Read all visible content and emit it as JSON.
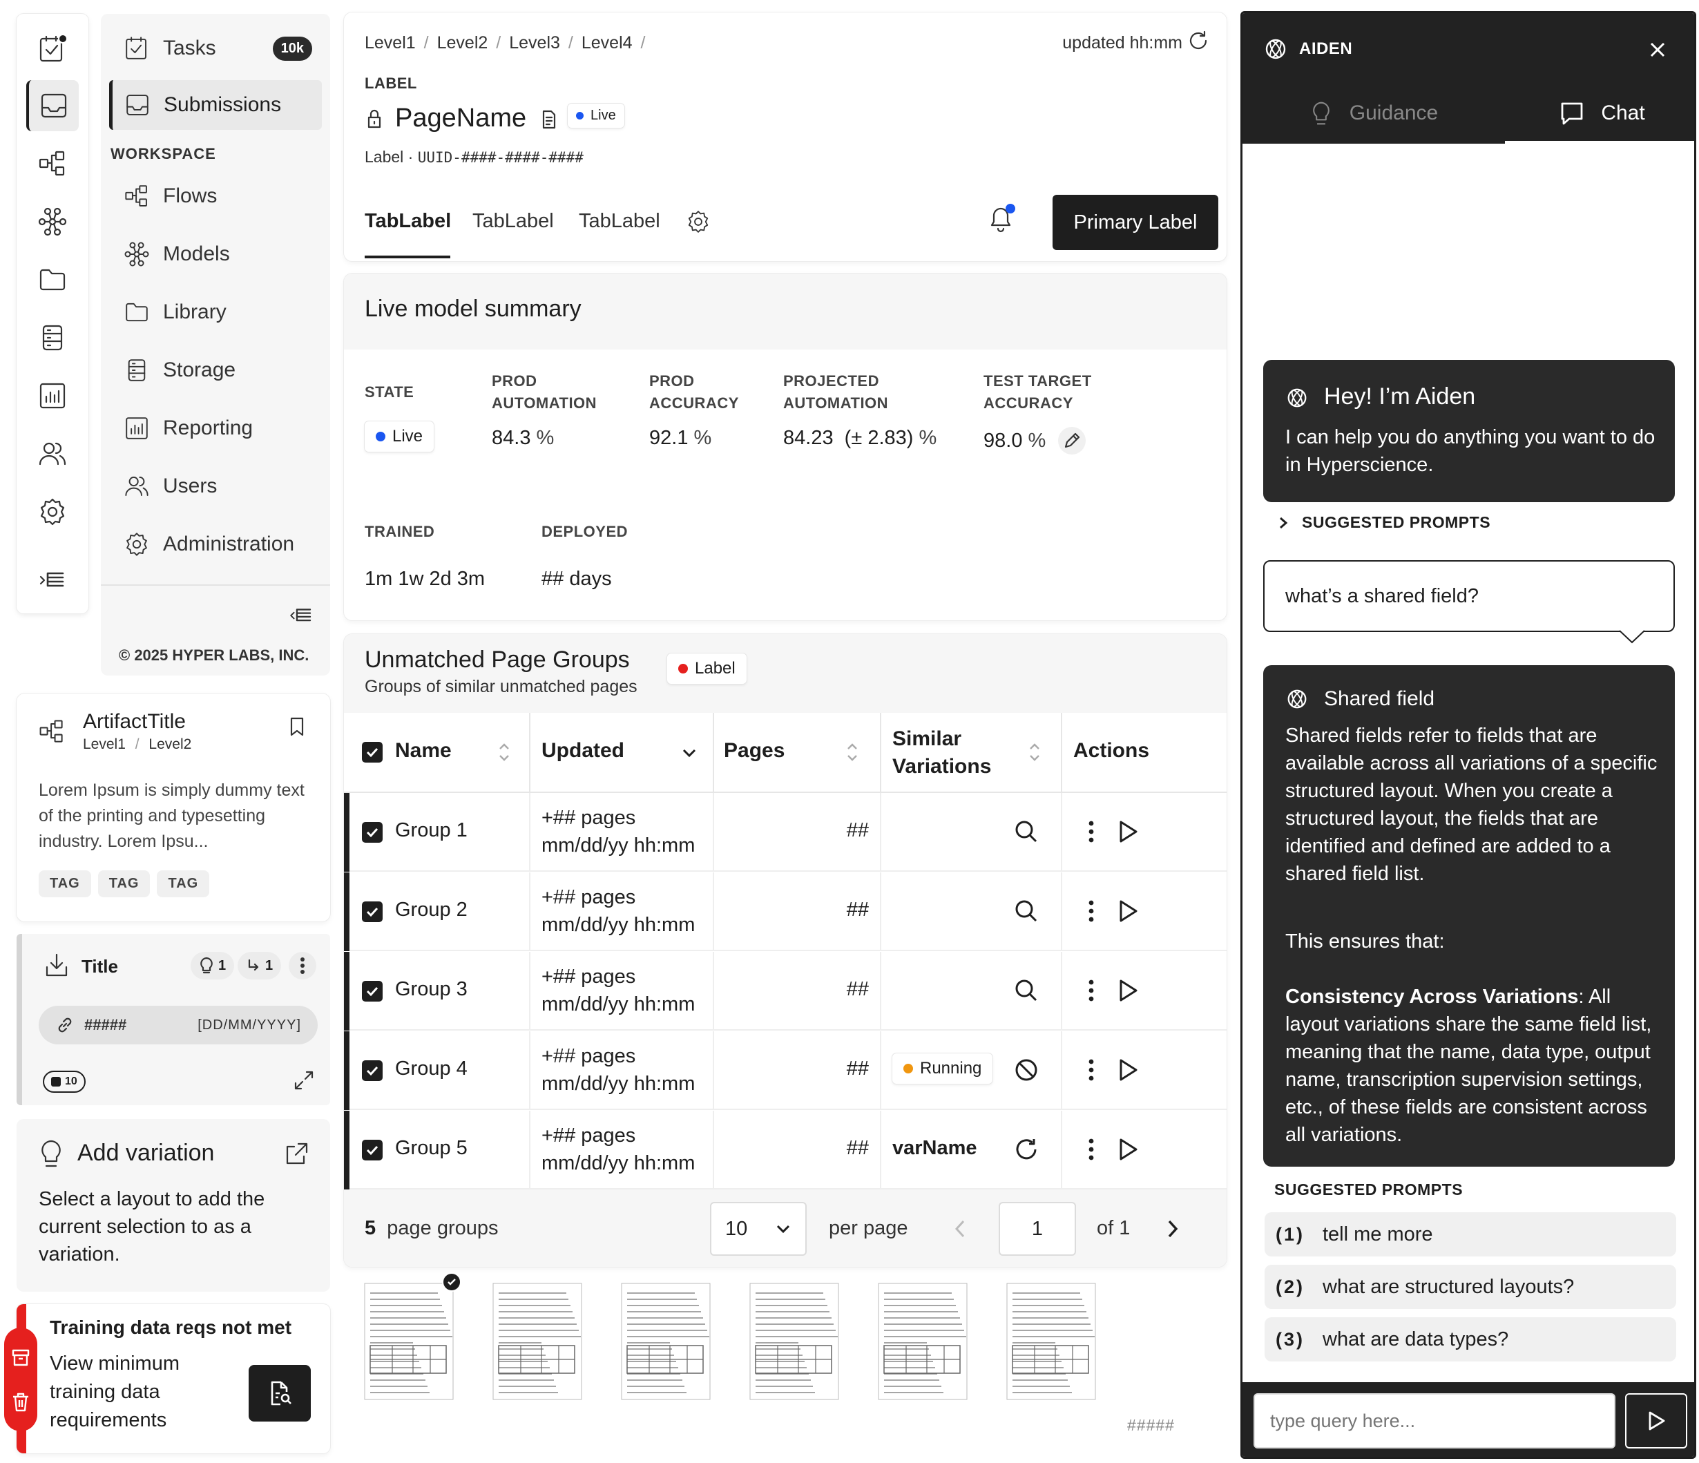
{
  "nav": {
    "items": [
      {
        "label": "Tasks",
        "badge": "10k"
      },
      {
        "label": "Submissions"
      },
      {
        "label": "Flows"
      },
      {
        "label": "Models"
      },
      {
        "label": "Library"
      },
      {
        "label": "Storage"
      },
      {
        "label": "Reporting"
      },
      {
        "label": "Users"
      },
      {
        "label": "Administration"
      }
    ],
    "section_label": "WORKSPACE",
    "copyright": "© 2025 HYPER LABS, INC."
  },
  "artifact": {
    "title": "ArtifactTitle",
    "breadcrumb": [
      "Level1",
      "Level2"
    ],
    "description": "Lorem Ipsum is simply dummy text of the printing and typesetting industry. Lorem Ipsu...",
    "tags": [
      "TAG",
      "TAG",
      "TAG"
    ]
  },
  "title_card": {
    "title": "Title",
    "bulb_count": "1",
    "branch_count": "1",
    "field_id": "#####",
    "field_date": "[DD/MM/YYYY]",
    "count_badge": "10"
  },
  "add_variation": {
    "title": "Add variation",
    "body": "Select a layout to add the current selection to as a variation."
  },
  "training_alert": {
    "title": "Training data reqs not met",
    "body": "View minimum training data requirements"
  },
  "header": {
    "breadcrumb": [
      "Level1",
      "Level2",
      "Level3",
      "Level4"
    ],
    "updated": "updated hh:mm",
    "label": "LABEL",
    "page_name": "PageName",
    "status": "Live",
    "meta_label": "Label",
    "uuid": "UUID-####-####-####",
    "tabs": [
      "TabLabel",
      "TabLabel",
      "TabLabel"
    ],
    "primary_button": "Primary Label"
  },
  "summary": {
    "title": "Live model summary",
    "state_label": "STATE",
    "state_value": "Live",
    "metrics": [
      {
        "label_1": "PROD",
        "label_2": "AUTOMATION",
        "value": "84.3",
        "unit": "%"
      },
      {
        "label_1": "PROD",
        "label_2": "ACCURACY",
        "value": "92.1",
        "unit": "%"
      },
      {
        "label_1": "PROJECTED",
        "label_2": "AUTOMATION",
        "value": "84.23  (± 2.83)",
        "unit": "%"
      },
      {
        "label_1": "TEST TARGET",
        "label_2": "ACCURACY",
        "value": "98.0",
        "unit": "%"
      }
    ],
    "trained_label": "TRAINED",
    "trained_value": "1m 1w 2d 3m",
    "deployed_label": "DEPLOYED",
    "deployed_value": "## days"
  },
  "groups": {
    "title": "Unmatched Page Groups",
    "subtitle": "Groups of similar unmatched pages",
    "label_pill": "Label",
    "columns": [
      "Name",
      "Updated",
      "Pages",
      "Similar Variations",
      "Actions"
    ],
    "col_similar_1": "Similar",
    "col_similar_2": "Variations",
    "rows": [
      {
        "name": "Group 1",
        "pages_line": "+## pages",
        "updated": "mm/dd/yy hh:mm",
        "count": "##",
        "similar": "",
        "action": "search"
      },
      {
        "name": "Group 2",
        "pages_line": "+## pages",
        "updated": "mm/dd/yy hh:mm",
        "count": "##",
        "similar": "",
        "action": "search"
      },
      {
        "name": "Group 3",
        "pages_line": "+## pages",
        "updated": "mm/dd/yy hh:mm",
        "count": "##",
        "similar": "",
        "action": "search"
      },
      {
        "name": "Group 4",
        "pages_line": "+## pages",
        "updated": "mm/dd/yy hh:mm",
        "count": "##",
        "similar": "Running",
        "action": "block"
      },
      {
        "name": "Group 5",
        "pages_line": "+## pages",
        "updated": "mm/dd/yy hh:mm",
        "count": "##",
        "similar": "varName",
        "action": "refresh"
      }
    ],
    "footer": {
      "count": "5",
      "count_label": "page groups",
      "per_page_value": "10",
      "per_page_label": "per page",
      "page": "1",
      "of_label": "of 1"
    },
    "thumb_caption": "#####"
  },
  "aiden": {
    "name": "AIDEN",
    "tabs": [
      "Guidance",
      "Chat"
    ],
    "greeting_title": "Hey! I’m Aiden",
    "greeting_body": "I can help you do anything you want to do in Hyperscience.",
    "suggested_label": "SUGGESTED PROMPTS",
    "user_message": "what’s a shared field?",
    "answer_title": "Shared field",
    "answer_p1": "Shared fields refer to fields that are available across all variations of a specific structured layout. When you create a structured layout, the fields that are identified and defined are added to a shared field list.",
    "answer_p2": "This ensures that:",
    "answer_bold": "Consistency Across Variations",
    "answer_p3": ": All layout variations share the same field list, meaning that the name, data type, output name, transcription supervision settings, etc., of these fields are consistent across all variations.",
    "prompts": [
      {
        "num": "(1)",
        "text": "tell me more"
      },
      {
        "num": "(2)",
        "text": "what are structured layouts?"
      },
      {
        "num": "(3)",
        "text": "what are data types?"
      }
    ],
    "input_placeholder": "type query here..."
  },
  "colors": {
    "accent_blue": "#1a56f0",
    "red": "#e5201e",
    "orange": "#f0960f",
    "dark": "#1e1e1e"
  }
}
